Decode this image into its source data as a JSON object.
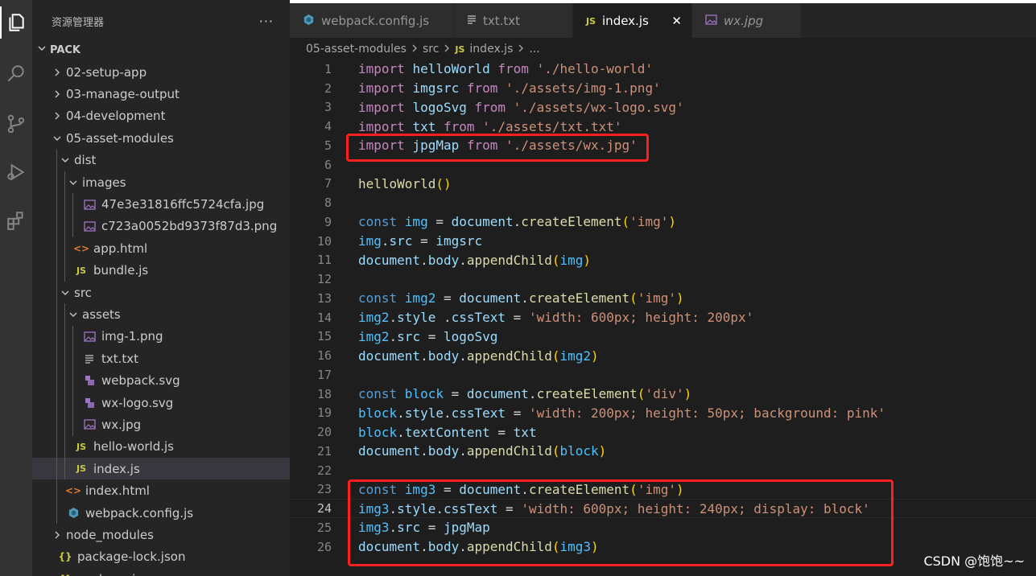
{
  "explorer": {
    "title": "资源管理器",
    "more": "···",
    "section": "PACK",
    "tree": [
      {
        "label": "02-setup-app",
        "kind": "folder",
        "depth": 0,
        "expanded": false
      },
      {
        "label": "03-manage-output",
        "kind": "folder",
        "depth": 0,
        "expanded": false
      },
      {
        "label": "04-development",
        "kind": "folder",
        "depth": 0,
        "expanded": false
      },
      {
        "label": "05-asset-modules",
        "kind": "folder",
        "depth": 0,
        "expanded": true
      },
      {
        "label": "dist",
        "kind": "folder",
        "depth": 1,
        "expanded": true
      },
      {
        "label": "images",
        "kind": "folder",
        "depth": 2,
        "expanded": true
      },
      {
        "label": "47e3e31816ffc5724cfa.jpg",
        "kind": "image",
        "depth": 3
      },
      {
        "label": "c723a0052bd9373f87d3.png",
        "kind": "image",
        "depth": 3
      },
      {
        "label": "app.html",
        "kind": "html",
        "depth": 2
      },
      {
        "label": "bundle.js",
        "kind": "js",
        "depth": 2
      },
      {
        "label": "src",
        "kind": "folder",
        "depth": 1,
        "expanded": true
      },
      {
        "label": "assets",
        "kind": "folder",
        "depth": 2,
        "expanded": true
      },
      {
        "label": "img-1.png",
        "kind": "image",
        "depth": 3
      },
      {
        "label": "txt.txt",
        "kind": "text",
        "depth": 3
      },
      {
        "label": "webpack.svg",
        "kind": "svg",
        "depth": 3
      },
      {
        "label": "wx-logo.svg",
        "kind": "svg",
        "depth": 3
      },
      {
        "label": "wx.jpg",
        "kind": "image",
        "depth": 3
      },
      {
        "label": "hello-world.js",
        "kind": "js",
        "depth": 2
      },
      {
        "label": "index.js",
        "kind": "js",
        "depth": 2,
        "selected": true
      },
      {
        "label": "index.html",
        "kind": "html",
        "depth": 1
      },
      {
        "label": "webpack.config.js",
        "kind": "webpack",
        "depth": 1
      },
      {
        "label": "node_modules",
        "kind": "folder",
        "depth": 0,
        "expanded": false
      },
      {
        "label": "package-lock.json",
        "kind": "json",
        "depth": 0
      },
      {
        "label": "package.json",
        "kind": "json",
        "depth": 0
      }
    ]
  },
  "tabs": [
    {
      "label": "webpack.config.js",
      "icon": "webpack-icon",
      "active": false
    },
    {
      "label": "txt.txt",
      "icon": "text-file-icon",
      "active": false
    },
    {
      "label": "index.js",
      "icon": "js-file-icon",
      "active": true,
      "close": "✕"
    },
    {
      "label": "wx.jpg",
      "icon": "image-file-icon",
      "active": false,
      "italic": true
    }
  ],
  "breadcrumb": [
    "05-asset-modules",
    "src",
    "index.js",
    "..."
  ],
  "breadcrumb_js_badge": "JS",
  "code": {
    "current_line": 24,
    "lines": [
      [
        [
          "import ",
          "kw"
        ],
        [
          "helloWorld ",
          "vb"
        ],
        [
          "from ",
          "kw"
        ],
        [
          "'./hello-world'",
          "st"
        ]
      ],
      [
        [
          "import ",
          "kw"
        ],
        [
          "imgsrc ",
          "vb"
        ],
        [
          "from ",
          "kw"
        ],
        [
          "'./assets/img-1.png'",
          "st"
        ]
      ],
      [
        [
          "import ",
          "kw"
        ],
        [
          "logoSvg ",
          "vb"
        ],
        [
          "from ",
          "kw"
        ],
        [
          "'./assets/wx-logo.svg'",
          "st"
        ]
      ],
      [
        [
          "import ",
          "kw"
        ],
        [
          "txt ",
          "vb"
        ],
        [
          "from ",
          "kw"
        ],
        [
          "'./assets/txt.txt'",
          "st"
        ]
      ],
      [
        [
          "import ",
          "kw"
        ],
        [
          "jpgMap ",
          "vb"
        ],
        [
          "from ",
          "kw"
        ],
        [
          "'./assets/wx.jpg'",
          "st"
        ]
      ],
      [],
      [
        [
          "helloWorld",
          "fn"
        ],
        [
          "()",
          "pn"
        ]
      ],
      [],
      [
        [
          "const ",
          "kb"
        ],
        [
          "img ",
          "vc"
        ],
        [
          "= ",
          "pl"
        ],
        [
          "document",
          "vb"
        ],
        [
          ".",
          "pl"
        ],
        [
          "createElement",
          "fn"
        ],
        [
          "(",
          "pn"
        ],
        [
          "'img'",
          "st"
        ],
        [
          ")",
          "pn"
        ]
      ],
      [
        [
          "img",
          "vc"
        ],
        [
          ".",
          "pl"
        ],
        [
          "src ",
          "vb"
        ],
        [
          "= ",
          "pl"
        ],
        [
          "imgsrc",
          "vb"
        ]
      ],
      [
        [
          "document",
          "vb"
        ],
        [
          ".",
          "pl"
        ],
        [
          "body",
          "vb"
        ],
        [
          ".",
          "pl"
        ],
        [
          "appendChild",
          "fn"
        ],
        [
          "(",
          "pn"
        ],
        [
          "img",
          "vc"
        ],
        [
          ")",
          "pn"
        ]
      ],
      [],
      [
        [
          "const ",
          "kb"
        ],
        [
          "img2 ",
          "vc"
        ],
        [
          "= ",
          "pl"
        ],
        [
          "document",
          "vb"
        ],
        [
          ".",
          "pl"
        ],
        [
          "createElement",
          "fn"
        ],
        [
          "(",
          "pn"
        ],
        [
          "'img'",
          "st"
        ],
        [
          ")",
          "pn"
        ]
      ],
      [
        [
          "img2",
          "vc"
        ],
        [
          ".",
          "pl"
        ],
        [
          "style ",
          "vb"
        ],
        [
          ".",
          "pl"
        ],
        [
          "cssText ",
          "vb"
        ],
        [
          "= ",
          "pl"
        ],
        [
          "'width: 600px; height: 200px'",
          "st"
        ]
      ],
      [
        [
          "img2",
          "vc"
        ],
        [
          ".",
          "pl"
        ],
        [
          "src ",
          "vb"
        ],
        [
          "= ",
          "pl"
        ],
        [
          "logoSvg",
          "vb"
        ]
      ],
      [
        [
          "document",
          "vb"
        ],
        [
          ".",
          "pl"
        ],
        [
          "body",
          "vb"
        ],
        [
          ".",
          "pl"
        ],
        [
          "appendChild",
          "fn"
        ],
        [
          "(",
          "pn"
        ],
        [
          "img2",
          "vc"
        ],
        [
          ")",
          "pn"
        ]
      ],
      [],
      [
        [
          "const ",
          "kb"
        ],
        [
          "block ",
          "vc"
        ],
        [
          "= ",
          "pl"
        ],
        [
          "document",
          "vb"
        ],
        [
          ".",
          "pl"
        ],
        [
          "createElement",
          "fn"
        ],
        [
          "(",
          "pn"
        ],
        [
          "'div'",
          "st"
        ],
        [
          ")",
          "pn"
        ]
      ],
      [
        [
          "block",
          "vc"
        ],
        [
          ".",
          "pl"
        ],
        [
          "style",
          "vb"
        ],
        [
          ".",
          "pl"
        ],
        [
          "cssText ",
          "vb"
        ],
        [
          "= ",
          "pl"
        ],
        [
          "'width: 200px; height: 50px; background: pink'",
          "st"
        ]
      ],
      [
        [
          "block",
          "vc"
        ],
        [
          ".",
          "pl"
        ],
        [
          "textContent ",
          "vb"
        ],
        [
          "= ",
          "pl"
        ],
        [
          "txt",
          "vb"
        ]
      ],
      [
        [
          "document",
          "vb"
        ],
        [
          ".",
          "pl"
        ],
        [
          "body",
          "vb"
        ],
        [
          ".",
          "pl"
        ],
        [
          "appendChild",
          "fn"
        ],
        [
          "(",
          "pn"
        ],
        [
          "block",
          "vc"
        ],
        [
          ")",
          "pn"
        ]
      ],
      [],
      [
        [
          "const ",
          "kb"
        ],
        [
          "img3 ",
          "vc"
        ],
        [
          "= ",
          "pl"
        ],
        [
          "document",
          "vb"
        ],
        [
          ".",
          "pl"
        ],
        [
          "createElement",
          "fn"
        ],
        [
          "(",
          "pn"
        ],
        [
          "'img'",
          "st"
        ],
        [
          ")",
          "pn"
        ]
      ],
      [
        [
          "img3",
          "vc"
        ],
        [
          ".",
          "pl"
        ],
        [
          "style",
          "vb"
        ],
        [
          ".",
          "pl"
        ],
        [
          "cssText ",
          "vb"
        ],
        [
          "= ",
          "pl"
        ],
        [
          "'width: 600px; height: 240px; display: block'",
          "st"
        ]
      ],
      [
        [
          "img3",
          "vc"
        ],
        [
          ".",
          "pl"
        ],
        [
          "src ",
          "vb"
        ],
        [
          "= ",
          "pl"
        ],
        [
          "jpgMap",
          "vb"
        ]
      ],
      [
        [
          "document",
          "vb"
        ],
        [
          ".",
          "pl"
        ],
        [
          "body",
          "vb"
        ],
        [
          ".",
          "pl"
        ],
        [
          "appendChild",
          "fn"
        ],
        [
          "(",
          "pn"
        ],
        [
          "img3",
          "vc"
        ],
        [
          ")",
          "pn"
        ]
      ]
    ]
  },
  "highlights": [
    {
      "label": "import-line-highlight",
      "from_line": 5,
      "to_line": 5
    },
    {
      "label": "img3-block-highlight",
      "from_line": 23,
      "to_line": 26
    }
  ],
  "watermark": "CSDN @饱饱~~",
  "colors": {
    "activity_bar": "#333333",
    "sidebar": "#252526",
    "editor": "#1e1e1e",
    "highlight_border": "#ff1f1f",
    "js_badge": "#cbcb41"
  }
}
